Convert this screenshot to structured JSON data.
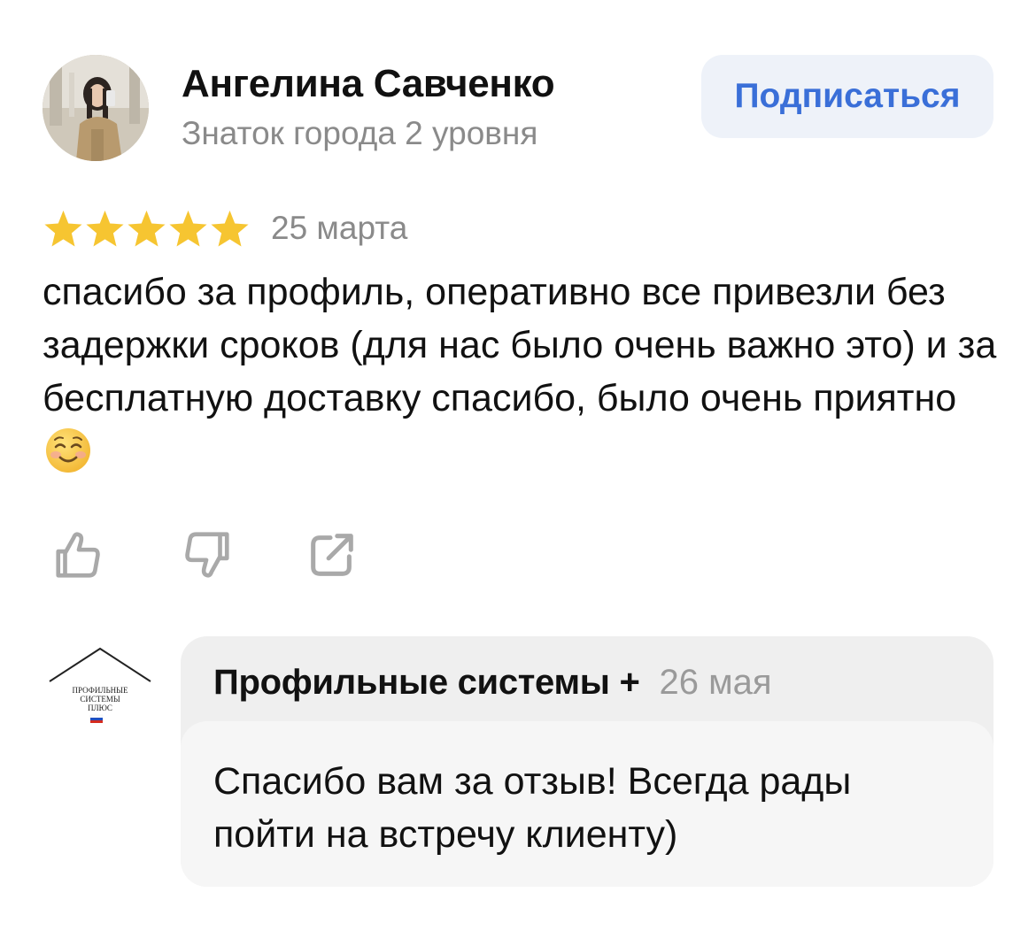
{
  "review": {
    "author_name": "Ангелина Савченко",
    "author_level": "Знаток города 2 уровня",
    "subscribe_label": "Подписаться",
    "rating": 5,
    "rating_max": 5,
    "date": "25 марта",
    "text": "спасибо за профиль,  оперативно все привезли без задержки сроков (для нас было очень важно это) и за бесплатную доставку спасибо, было очень приятно",
    "emoji": "smiling-face-with-smiling-eyes"
  },
  "actions": {
    "like_icon": "thumbs-up-icon",
    "dislike_icon": "thumbs-down-icon",
    "share_icon": "share-icon"
  },
  "reply": {
    "company_name": "Профильные системы +",
    "date": "26 мая",
    "text": "Спасибо вам за отзыв! Всегда рады пойти на встречу клиенту)",
    "logo": {
      "line1": "ПРОФИЛЬНЫЕ",
      "line2": "СИСТЕМЫ",
      "line3": "ПЛЮС"
    }
  },
  "colors": {
    "star": "#f6c531",
    "accent": "#3a6fd8",
    "muted": "#8a8a8a",
    "icon": "#a9a9a9"
  }
}
